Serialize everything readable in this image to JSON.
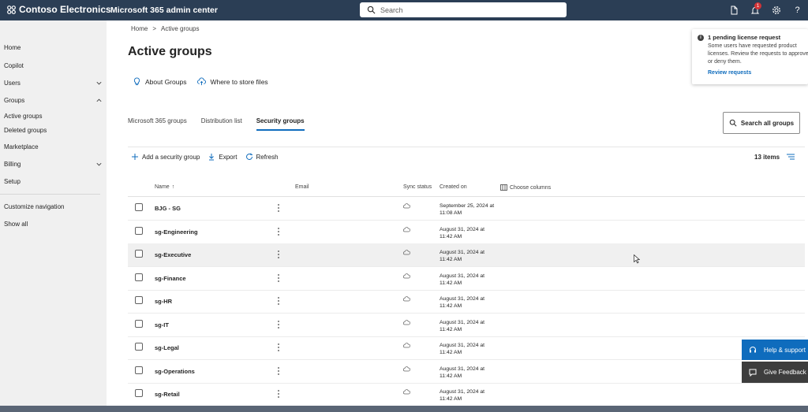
{
  "topbar": {
    "brand": "Contoso Electronics",
    "app_title": "Microsoft 365 admin center",
    "search_placeholder": "Search",
    "notification_count": "1"
  },
  "sidebar": {
    "items": [
      {
        "label": "Home"
      },
      {
        "label": "Copilot"
      },
      {
        "label": "Users"
      },
      {
        "label": "Groups"
      },
      {
        "label": "Active groups"
      },
      {
        "label": "Deleted groups"
      },
      {
        "label": "Marketplace"
      },
      {
        "label": "Billing"
      },
      {
        "label": "Setup"
      },
      {
        "label": "Customize navigation"
      },
      {
        "label": "Show all"
      }
    ]
  },
  "breadcrumb": {
    "home": "Home",
    "sep": ">",
    "current": "Active groups"
  },
  "page_title": "Active groups",
  "links": {
    "about": "About Groups",
    "store": "Where to store files"
  },
  "tabs": [
    {
      "label": "Microsoft 365 groups"
    },
    {
      "label": "Distribution list"
    },
    {
      "label": "Security groups"
    }
  ],
  "search_all_label": "Search all groups",
  "toolbar": {
    "add": "Add a security group",
    "export": "Export",
    "refresh": "Refresh"
  },
  "item_count": "13 items",
  "table": {
    "headers": {
      "name": "Name",
      "sort": "↑",
      "email": "Email",
      "sync": "Sync status",
      "created": "Created on",
      "choose": "Choose columns"
    },
    "rows": [
      {
        "name": "BJG - SG",
        "created_1": "September 25, 2024 at",
        "created_2": "11:08 AM"
      },
      {
        "name": "sg-Engineering",
        "created_1": "August 31, 2024 at",
        "created_2": "11:42 AM"
      },
      {
        "name": "sg-Executive",
        "created_1": "August 31, 2024 at",
        "created_2": "11:42 AM"
      },
      {
        "name": "sg-Finance",
        "created_1": "August 31, 2024 at",
        "created_2": "11:42 AM"
      },
      {
        "name": "sg-HR",
        "created_1": "August 31, 2024 at",
        "created_2": "11:42 AM"
      },
      {
        "name": "sg-IT",
        "created_1": "August 31, 2024 at",
        "created_2": "11:42 AM"
      },
      {
        "name": "sg-Legal",
        "created_1": "August 31, 2024 at",
        "created_2": "11:42 AM"
      },
      {
        "name": "sg-Operations",
        "created_1": "August 31, 2024 at",
        "created_2": "11:42 AM"
      },
      {
        "name": "sg-Retail",
        "created_1": "August 31, 2024 at",
        "created_2": "11:42 AM"
      }
    ]
  },
  "notice": {
    "title": "1 pending license request",
    "body": "Some users have requested product licenses. Review the requests to approve or deny them.",
    "link": "Review requests"
  },
  "help_label": "Help & support",
  "feedback_label": "Give Feedback",
  "colors": {
    "topbar": "#2b3e55",
    "accent": "#0f6cbd",
    "sidebar": "#f0f0f0",
    "badge": "#d13438"
  }
}
